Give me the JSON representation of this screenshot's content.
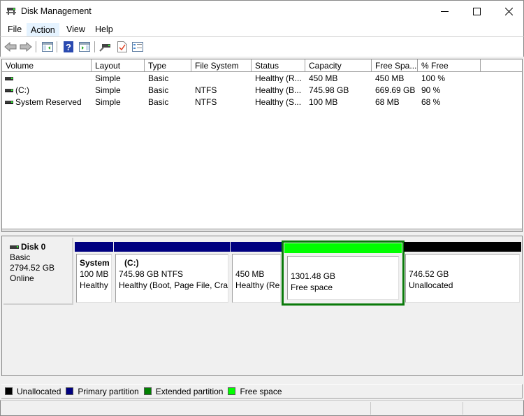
{
  "window": {
    "title": "Disk Management",
    "icons": {
      "app": "disk-management-icon",
      "minimize": "minimize-icon",
      "maximize": "maximize-icon",
      "close": "close-icon"
    }
  },
  "menu": {
    "items": [
      {
        "label": "File"
      },
      {
        "label": "Action",
        "active": true
      },
      {
        "label": "View"
      },
      {
        "label": "Help"
      }
    ]
  },
  "toolbar": {
    "buttons": [
      {
        "name": "back-button",
        "icon": "back-arrow-icon"
      },
      {
        "name": "forward-button",
        "icon": "forward-arrow-icon"
      },
      {
        "name": "show-hide-console-tree-button",
        "icon": "console-tree-icon"
      },
      {
        "name": "help-button",
        "icon": "help-icon"
      },
      {
        "name": "show-hide-action-pane-button",
        "icon": "action-pane-icon"
      },
      {
        "name": "connect-disk-button",
        "icon": "connect-disk-icon"
      },
      {
        "name": "check-button",
        "icon": "checklist-icon"
      },
      {
        "name": "properties-button",
        "icon": "properties-icon"
      }
    ]
  },
  "volume_list": {
    "columns": [
      "Volume",
      "Layout",
      "Type",
      "File System",
      "Status",
      "Capacity",
      "Free Spa...",
      "% Free"
    ],
    "rows": [
      {
        "volume": "",
        "layout": "Simple",
        "type": "Basic",
        "file_system": "",
        "status": "Healthy (R...",
        "capacity": "450 MB",
        "free_space": "450 MB",
        "pct_free": "100 %"
      },
      {
        "volume": " (C:)",
        "layout": "Simple",
        "type": "Basic",
        "file_system": "NTFS",
        "status": "Healthy (B...",
        "capacity": "745.98 GB",
        "free_space": "669.69 GB",
        "pct_free": "90 %"
      },
      {
        "volume": "System Reserved",
        "layout": "Simple",
        "type": "Basic",
        "file_system": "NTFS",
        "status": "Healthy (S...",
        "capacity": "100 MB",
        "free_space": "68 MB",
        "pct_free": "68 %"
      }
    ]
  },
  "disk": {
    "name": "Disk 0",
    "type": "Basic",
    "size": "2794.52 GB",
    "status": "Online",
    "partitions": [
      {
        "title": "System",
        "size": "100 MB",
        "status": "Healthy",
        "kind": "primary"
      },
      {
        "title": "(C:)",
        "size": "745.98 GB NTFS",
        "status": "Healthy (Boot, Page File, Cra",
        "kind": "primary"
      },
      {
        "title": "",
        "size": "450 MB",
        "status": "Healthy (Re",
        "kind": "primary"
      },
      {
        "title": "",
        "size": "1301.48 GB",
        "status": "Free space",
        "kind": "free",
        "selected": true
      },
      {
        "title": "",
        "size": "746.52 GB",
        "status": "Unallocated",
        "kind": "unallocated"
      }
    ]
  },
  "legend": [
    {
      "label": "Unallocated",
      "color": "#000000"
    },
    {
      "label": "Primary partition",
      "color": "#000080"
    },
    {
      "label": "Extended partition",
      "color": "#008000"
    },
    {
      "label": "Free space",
      "color": "#00ff00"
    }
  ],
  "colors": {
    "primary": "#000080",
    "free": "#00ff00",
    "unallocated": "#000000",
    "selection": "#0a7a0a",
    "menu_active": "#e5f3ff"
  }
}
